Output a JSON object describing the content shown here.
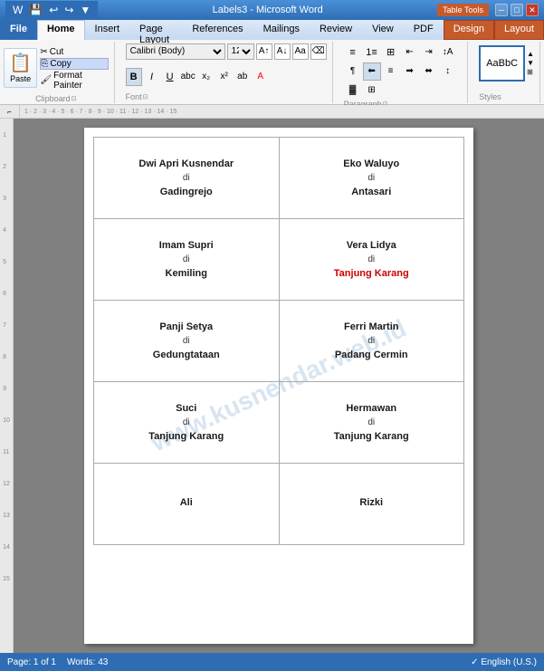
{
  "titleBar": {
    "title": "Labels3 - Microsoft Word",
    "tableTools": "Table Tools",
    "winBtns": [
      "─",
      "□",
      "✕"
    ]
  },
  "tabs": {
    "items": [
      "File",
      "Home",
      "Insert",
      "Page Layout",
      "References",
      "Mailings",
      "Review",
      "View",
      "PDF",
      "Design",
      "Layout"
    ]
  },
  "clipboard": {
    "pasteLabel": "Paste",
    "cutLabel": "Cut",
    "copyLabel": "Copy",
    "formatPainterLabel": "Format Painter"
  },
  "font": {
    "fontName": "Calibri (Body)",
    "fontSize": "12",
    "boldLabel": "B",
    "italicLabel": "I",
    "underlineLabel": "U"
  },
  "statusBar": {
    "page": "Page: 1 of 1",
    "words": "Words: 43",
    "language": "English (U.S.)"
  },
  "labels": [
    {
      "row": 0,
      "cells": [
        {
          "name": "Dwi Apri Kusnendar",
          "di": "di",
          "place": "Gadingrejo",
          "placeRed": false
        },
        {
          "name": "Eko Waluyo",
          "di": "di",
          "place": "Antasari",
          "placeRed": false
        }
      ]
    },
    {
      "row": 1,
      "cells": [
        {
          "name": "Imam Supri",
          "di": "di",
          "place": "Kemiling",
          "placeRed": false
        },
        {
          "name": "Vera Lidya",
          "di": "di",
          "place": "Tanjung Karang",
          "placeRed": true
        }
      ]
    },
    {
      "row": 2,
      "cells": [
        {
          "name": "Panji Setya",
          "di": "di",
          "place": "Gedungtataan",
          "placeRed": false
        },
        {
          "name": "Ferri Martin",
          "di": "di",
          "place": "Padang Cermin",
          "placeRed": false
        }
      ]
    },
    {
      "row": 3,
      "cells": [
        {
          "name": "Suci",
          "di": "di",
          "place": "Tanjung Karang",
          "placeRed": false
        },
        {
          "name": "Hermawan",
          "di": "di",
          "place": "Tanjung Karang",
          "placeRed": false
        }
      ]
    },
    {
      "row": 4,
      "cells": [
        {
          "name": "Ali",
          "di": "",
          "place": "",
          "placeRed": false
        },
        {
          "name": "Rizki",
          "di": "",
          "place": "",
          "placeRed": false
        }
      ]
    }
  ],
  "watermark": "www.kusnendar.web.id"
}
